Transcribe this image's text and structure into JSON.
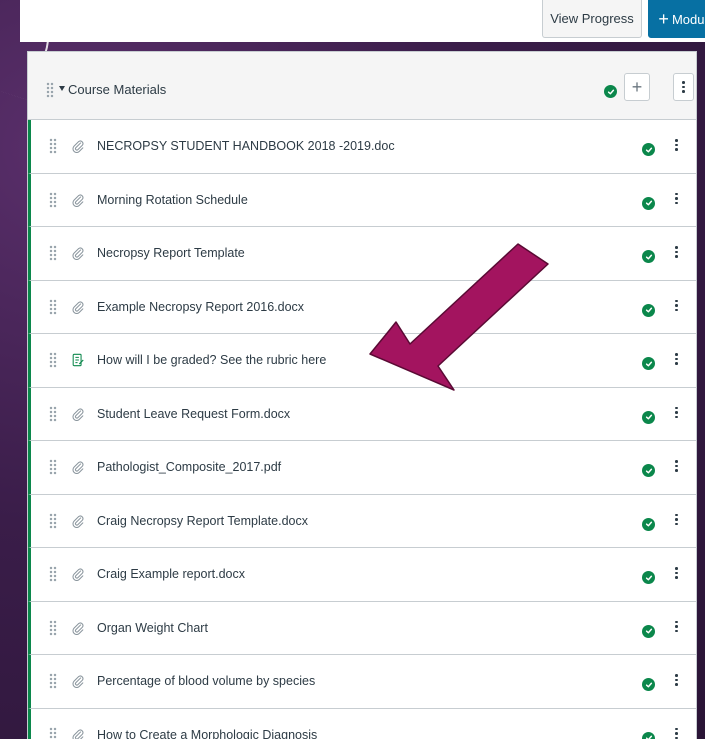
{
  "toolbar": {
    "view_progress_label": "View Progress",
    "add_module_plus": "+",
    "add_module_label": "Module"
  },
  "module": {
    "title": "Course Materials",
    "add_glyph": "+",
    "items": [
      {
        "icon": "attachment-icon",
        "title": "NECROPSY STUDENT HANDBOOK 2018 -2019.doc"
      },
      {
        "icon": "attachment-icon",
        "title": "Morning Rotation Schedule"
      },
      {
        "icon": "attachment-icon",
        "title": "Necropsy Report Template"
      },
      {
        "icon": "attachment-icon",
        "title": "Example Necropsy Report 2016.docx"
      },
      {
        "icon": "assignment-icon",
        "title": "How will I be graded? See the rubric here"
      },
      {
        "icon": "attachment-icon",
        "title": "Student Leave Request Form.docx"
      },
      {
        "icon": "attachment-icon",
        "title": "Pathologist_Composite_2017.pdf"
      },
      {
        "icon": "attachment-icon",
        "title": "Craig Necropsy Report Template.docx"
      },
      {
        "icon": "attachment-icon",
        "title": "Craig Example report.docx"
      },
      {
        "icon": "attachment-icon",
        "title": "Organ Weight Chart"
      },
      {
        "icon": "attachment-icon",
        "title": "Percentage of blood volume by species"
      },
      {
        "icon": "attachment-icon",
        "title": "How to Create a Morphologic Diagnosis"
      }
    ]
  },
  "colors": {
    "accent_blue": "#0770a3",
    "complete_green": "#0b874b",
    "arrow_magenta": "#a3145f",
    "background_purple": "#3b1f4a"
  }
}
